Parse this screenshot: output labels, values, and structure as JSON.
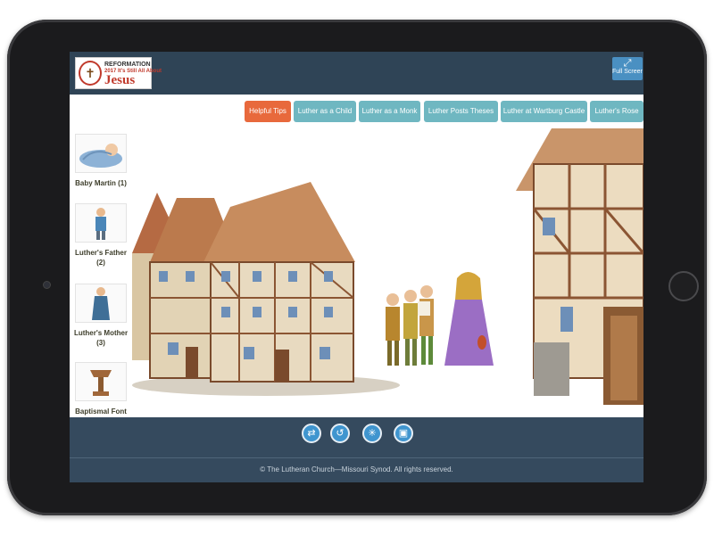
{
  "logo": {
    "line1": "REFORMATION",
    "line2": "2017 It's Still All About",
    "line3": "Jesus",
    "emblem": "cross-rose-emblem"
  },
  "header": {
    "fullscreen_label": "Full Screen",
    "fullscreen_icon": "expand-arrows-icon"
  },
  "tabs": [
    {
      "label": "Helpful Tips",
      "active": true
    },
    {
      "label": "Luther as a Child",
      "active": false
    },
    {
      "label": "Luther as a Monk",
      "active": false
    },
    {
      "label": "Luther Posts Theses",
      "active": false
    },
    {
      "label": "Luther at Wartburg Castle",
      "active": false
    },
    {
      "label": "Luther's Rose",
      "active": false
    }
  ],
  "sidebar": {
    "items": [
      {
        "label": "Baby Martin (1)"
      },
      {
        "label": "Luther's Father (2)"
      },
      {
        "label": "Luther's Mother (3)"
      },
      {
        "label": "Baptismal Font"
      }
    ]
  },
  "controls": [
    {
      "name": "swap-icon",
      "glyph": "⇄"
    },
    {
      "name": "undo-icon",
      "glyph": "↺"
    },
    {
      "name": "scatter-icon",
      "glyph": "✳"
    },
    {
      "name": "image-icon",
      "glyph": "▣"
    }
  ],
  "footer": {
    "copyright": "© The Lutheran Church—Missouri Synod. All rights reserved."
  },
  "colors": {
    "header_bg": "#2f4456",
    "tab_bg": "#6fb7c1",
    "tab_active_bg": "#e8693c",
    "control_bg": "#3f95cf"
  }
}
